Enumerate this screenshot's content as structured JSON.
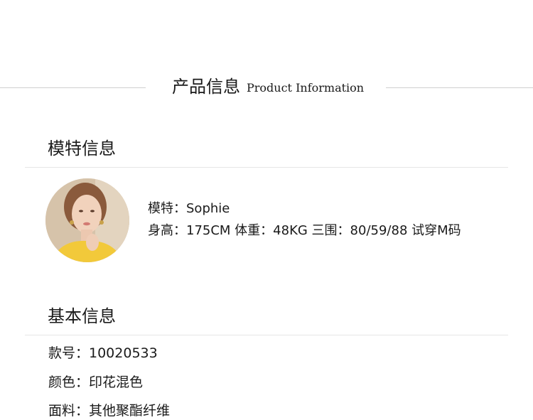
{
  "product_info": {
    "title_cn": "产品信息",
    "title_en": "Product Information"
  },
  "model_section": {
    "heading": "模特信息",
    "model_name_line": "模特：Sophie",
    "measurements_line": "身高：175CM  体重：48KG  三围：80/59/88  试穿M码"
  },
  "basic_section": {
    "heading": "基本信息",
    "rows": [
      "款号：10020533",
      "颜色：印花混色",
      "面料：其他聚酯纤维"
    ]
  },
  "colors": {
    "divider": "#cfcfcf",
    "text": "#1a1a1a",
    "shirt": "#f2c93a"
  },
  "icons": {
    "avatar": "model-photo"
  }
}
